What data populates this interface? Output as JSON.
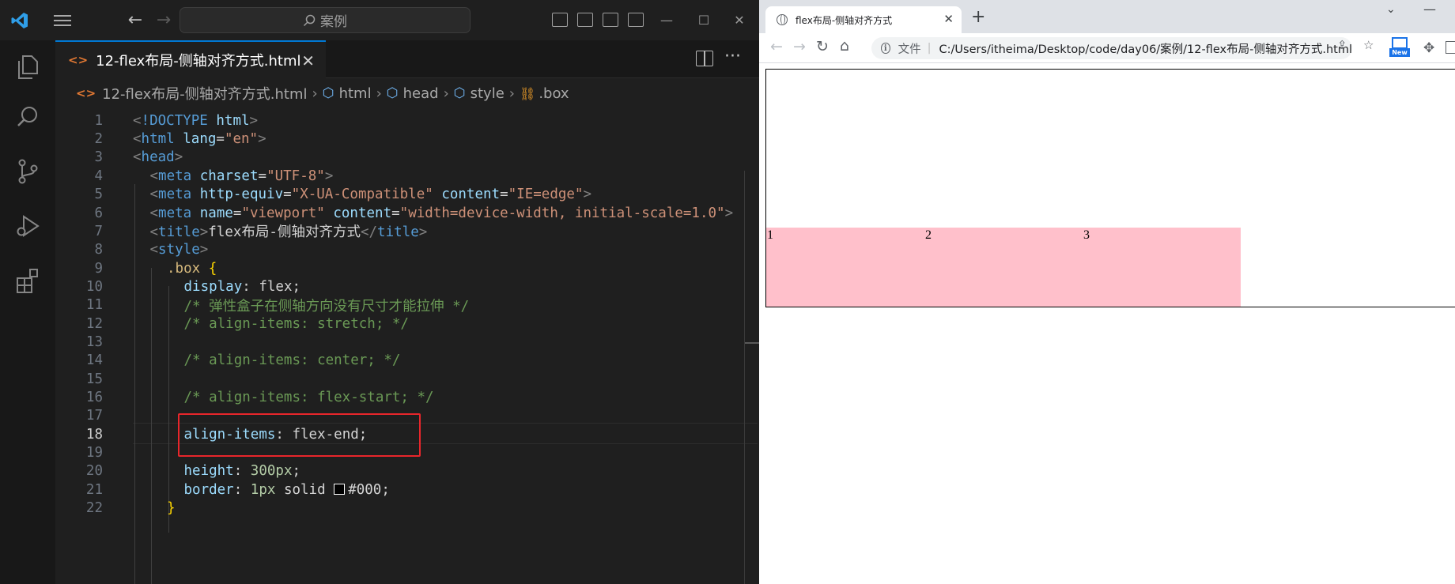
{
  "vscode": {
    "command_center": {
      "placeholder": "案例"
    },
    "tab": {
      "label": "12-flex布局-侧轴对齐方式.html"
    },
    "breadcrumb": [
      {
        "label": "12-flex布局-侧轴对齐方式.html",
        "icon": "html-file-icon"
      },
      {
        "label": "html",
        "icon": "symbol-element-icon"
      },
      {
        "label": "head",
        "icon": "symbol-element-icon"
      },
      {
        "label": "style",
        "icon": "symbol-element-icon"
      },
      {
        "label": ".box",
        "icon": "symbol-class-icon"
      }
    ],
    "current_line": 18,
    "highlighted_line": 18,
    "code_lines": [
      {
        "n": "1",
        "tokens": [
          [
            "punc",
            "<"
          ],
          [
            "tag",
            "!DOCTYPE"
          ],
          [
            "text",
            " "
          ],
          [
            "attr",
            "html"
          ],
          [
            "punc",
            ">"
          ]
        ]
      },
      {
        "n": "2",
        "tokens": [
          [
            "punc",
            "<"
          ],
          [
            "tag",
            "html"
          ],
          [
            "text",
            " "
          ],
          [
            "attr",
            "lang"
          ],
          [
            "text",
            "="
          ],
          [
            "str",
            "\"en\""
          ],
          [
            "punc",
            ">"
          ]
        ]
      },
      {
        "n": "3",
        "tokens": [
          [
            "punc",
            "<"
          ],
          [
            "tag",
            "head"
          ],
          [
            "punc",
            ">"
          ]
        ]
      },
      {
        "n": "4",
        "indent": 1,
        "tokens": [
          [
            "punc",
            "<"
          ],
          [
            "tag",
            "meta"
          ],
          [
            "text",
            " "
          ],
          [
            "attr",
            "charset"
          ],
          [
            "text",
            "="
          ],
          [
            "str",
            "\"UTF-8\""
          ],
          [
            "punc",
            ">"
          ]
        ]
      },
      {
        "n": "5",
        "indent": 1,
        "tokens": [
          [
            "punc",
            "<"
          ],
          [
            "tag",
            "meta"
          ],
          [
            "text",
            " "
          ],
          [
            "attr",
            "http-equiv"
          ],
          [
            "text",
            "="
          ],
          [
            "str",
            "\"X-UA-Compatible\""
          ],
          [
            "text",
            " "
          ],
          [
            "attr",
            "content"
          ],
          [
            "text",
            "="
          ],
          [
            "str",
            "\"IE=edge\""
          ],
          [
            "punc",
            ">"
          ]
        ]
      },
      {
        "n": "6",
        "indent": 1,
        "tokens": [
          [
            "punc",
            "<"
          ],
          [
            "tag",
            "meta"
          ],
          [
            "text",
            " "
          ],
          [
            "attr",
            "name"
          ],
          [
            "text",
            "="
          ],
          [
            "str",
            "\"viewport\""
          ],
          [
            "text",
            " "
          ],
          [
            "attr",
            "content"
          ],
          [
            "text",
            "="
          ],
          [
            "str",
            "\"width=device-width, initial-scale=1.0\""
          ],
          [
            "punc",
            ">"
          ]
        ]
      },
      {
        "n": "7",
        "indent": 1,
        "tokens": [
          [
            "punc",
            "<"
          ],
          [
            "tag",
            "title"
          ],
          [
            "punc",
            ">"
          ],
          [
            "text",
            "flex布局-侧轴对齐方式"
          ],
          [
            "punc",
            "</"
          ],
          [
            "tag",
            "title"
          ],
          [
            "punc",
            ">"
          ]
        ]
      },
      {
        "n": "8",
        "indent": 1,
        "tokens": [
          [
            "punc",
            "<"
          ],
          [
            "tag",
            "style"
          ],
          [
            "punc",
            ">"
          ]
        ]
      },
      {
        "n": "9",
        "indent": 2,
        "tokens": [
          [
            "sel",
            ".box"
          ],
          [
            "text",
            " "
          ],
          [
            "brace",
            "{"
          ]
        ]
      },
      {
        "n": "10",
        "indent": 3,
        "tokens": [
          [
            "prop",
            "display"
          ],
          [
            "text",
            ": "
          ],
          [
            "val",
            "flex"
          ],
          [
            "text",
            ";"
          ]
        ]
      },
      {
        "n": "11",
        "indent": 3,
        "tokens": [
          [
            "cmt",
            "/* 弹性盒子在侧轴方向没有尺寸才能拉伸 */"
          ]
        ]
      },
      {
        "n": "12",
        "indent": 3,
        "tokens": [
          [
            "cmt",
            "/* align-items: stretch; */"
          ]
        ]
      },
      {
        "n": "13",
        "indent": 3,
        "tokens": []
      },
      {
        "n": "14",
        "indent": 3,
        "tokens": [
          [
            "cmt",
            "/* align-items: center; */"
          ]
        ]
      },
      {
        "n": "15",
        "indent": 3,
        "tokens": []
      },
      {
        "n": "16",
        "indent": 3,
        "tokens": [
          [
            "cmt",
            "/* align-items: flex-start; */"
          ]
        ]
      },
      {
        "n": "17",
        "indent": 3,
        "tokens": []
      },
      {
        "n": "18",
        "indent": 3,
        "tokens": [
          [
            "prop",
            "align-items"
          ],
          [
            "text",
            ": "
          ],
          [
            "val",
            "flex-end"
          ],
          [
            "text",
            ";"
          ]
        ]
      },
      {
        "n": "19",
        "indent": 3,
        "tokens": []
      },
      {
        "n": "20",
        "indent": 3,
        "tokens": [
          [
            "prop",
            "height"
          ],
          [
            "text",
            ": "
          ],
          [
            "num",
            "300px"
          ],
          [
            "text",
            ";"
          ]
        ]
      },
      {
        "n": "21",
        "indent": 3,
        "tokens": [
          [
            "prop",
            "border"
          ],
          [
            "text",
            ": "
          ],
          [
            "num",
            "1px"
          ],
          [
            "text",
            " "
          ],
          [
            "val",
            "solid"
          ],
          [
            "text",
            " "
          ],
          [
            "swatch",
            ""
          ],
          [
            "val",
            "#000"
          ],
          [
            "text",
            ";"
          ]
        ]
      },
      {
        "n": "22",
        "indent": 2,
        "tokens": [
          [
            "brace",
            "}"
          ]
        ]
      }
    ]
  },
  "browser": {
    "tab_title": "flex布局-侧轴对齐方式",
    "address_label": "文件",
    "address_url": "C:/Users/itheima/Desktop/code/day06/案例/12-flex布局-侧轴对齐方式.html",
    "new_badge": "New",
    "items": [
      "1",
      "2",
      "3"
    ],
    "item_color": "pink"
  },
  "colors": {
    "accent": "#0078d4",
    "highlight_box": "#e8262b"
  }
}
